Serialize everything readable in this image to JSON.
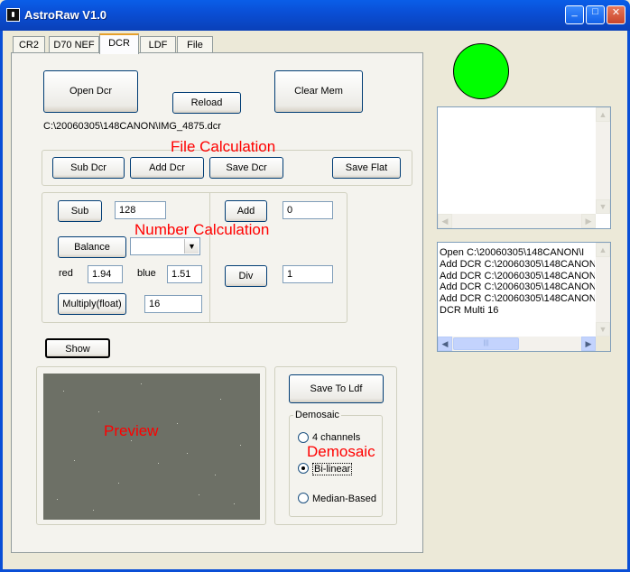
{
  "window": {
    "title": "AstroRaw V1.0",
    "btn_min": "_",
    "btn_max": "□",
    "btn_close": "✕"
  },
  "tabs": [
    "CR2",
    "D70 NEF",
    "DCR",
    "LDF",
    "File"
  ],
  "dcr": {
    "open_btn": "Open Dcr",
    "reload_btn": "Reload",
    "clear_btn": "Clear Mem",
    "path": "C:\\20060305\\148CANON\\IMG_4875.dcr",
    "file_calc_label": "File Calculation",
    "sub_dcr": "Sub Dcr",
    "add_dcr": "Add Dcr",
    "save_dcr": "Save Dcr",
    "save_flat": "Save Flat",
    "number_calc_label": "Number Calculation",
    "sub_btn": "Sub",
    "sub_value": "128",
    "balance_btn": "Balance",
    "balance_select": "",
    "red_label": "red",
    "red_value": "1.94",
    "blue_label": "blue",
    "blue_value": "1.51",
    "multiply_btn": "Multiply(float)",
    "multiply_value": "16",
    "add_btn": "Add",
    "add_value": "0",
    "div_btn": "Div",
    "div_value": "1",
    "show_btn": "Show",
    "preview_label": "Preview",
    "save_ldf": "Save To Ldf",
    "demosaic_group": "Demosaic",
    "demosaic_label": "Demosaic",
    "opt_4ch": "4 channels",
    "opt_bilinear": "Bi-linear",
    "opt_median": "Median-Based",
    "selected": "Bi-linear"
  },
  "status_indicator_color": "#00ff00",
  "log": [
    "Open   C:\\20060305\\148CANON\\I",
    "Add DCR C:\\20060305\\148CANON",
    "Add DCR C:\\20060305\\148CANON",
    "Add DCR C:\\20060305\\148CANON",
    "Add DCR C:\\20060305\\148CANON",
    "DCR Multi  16"
  ]
}
